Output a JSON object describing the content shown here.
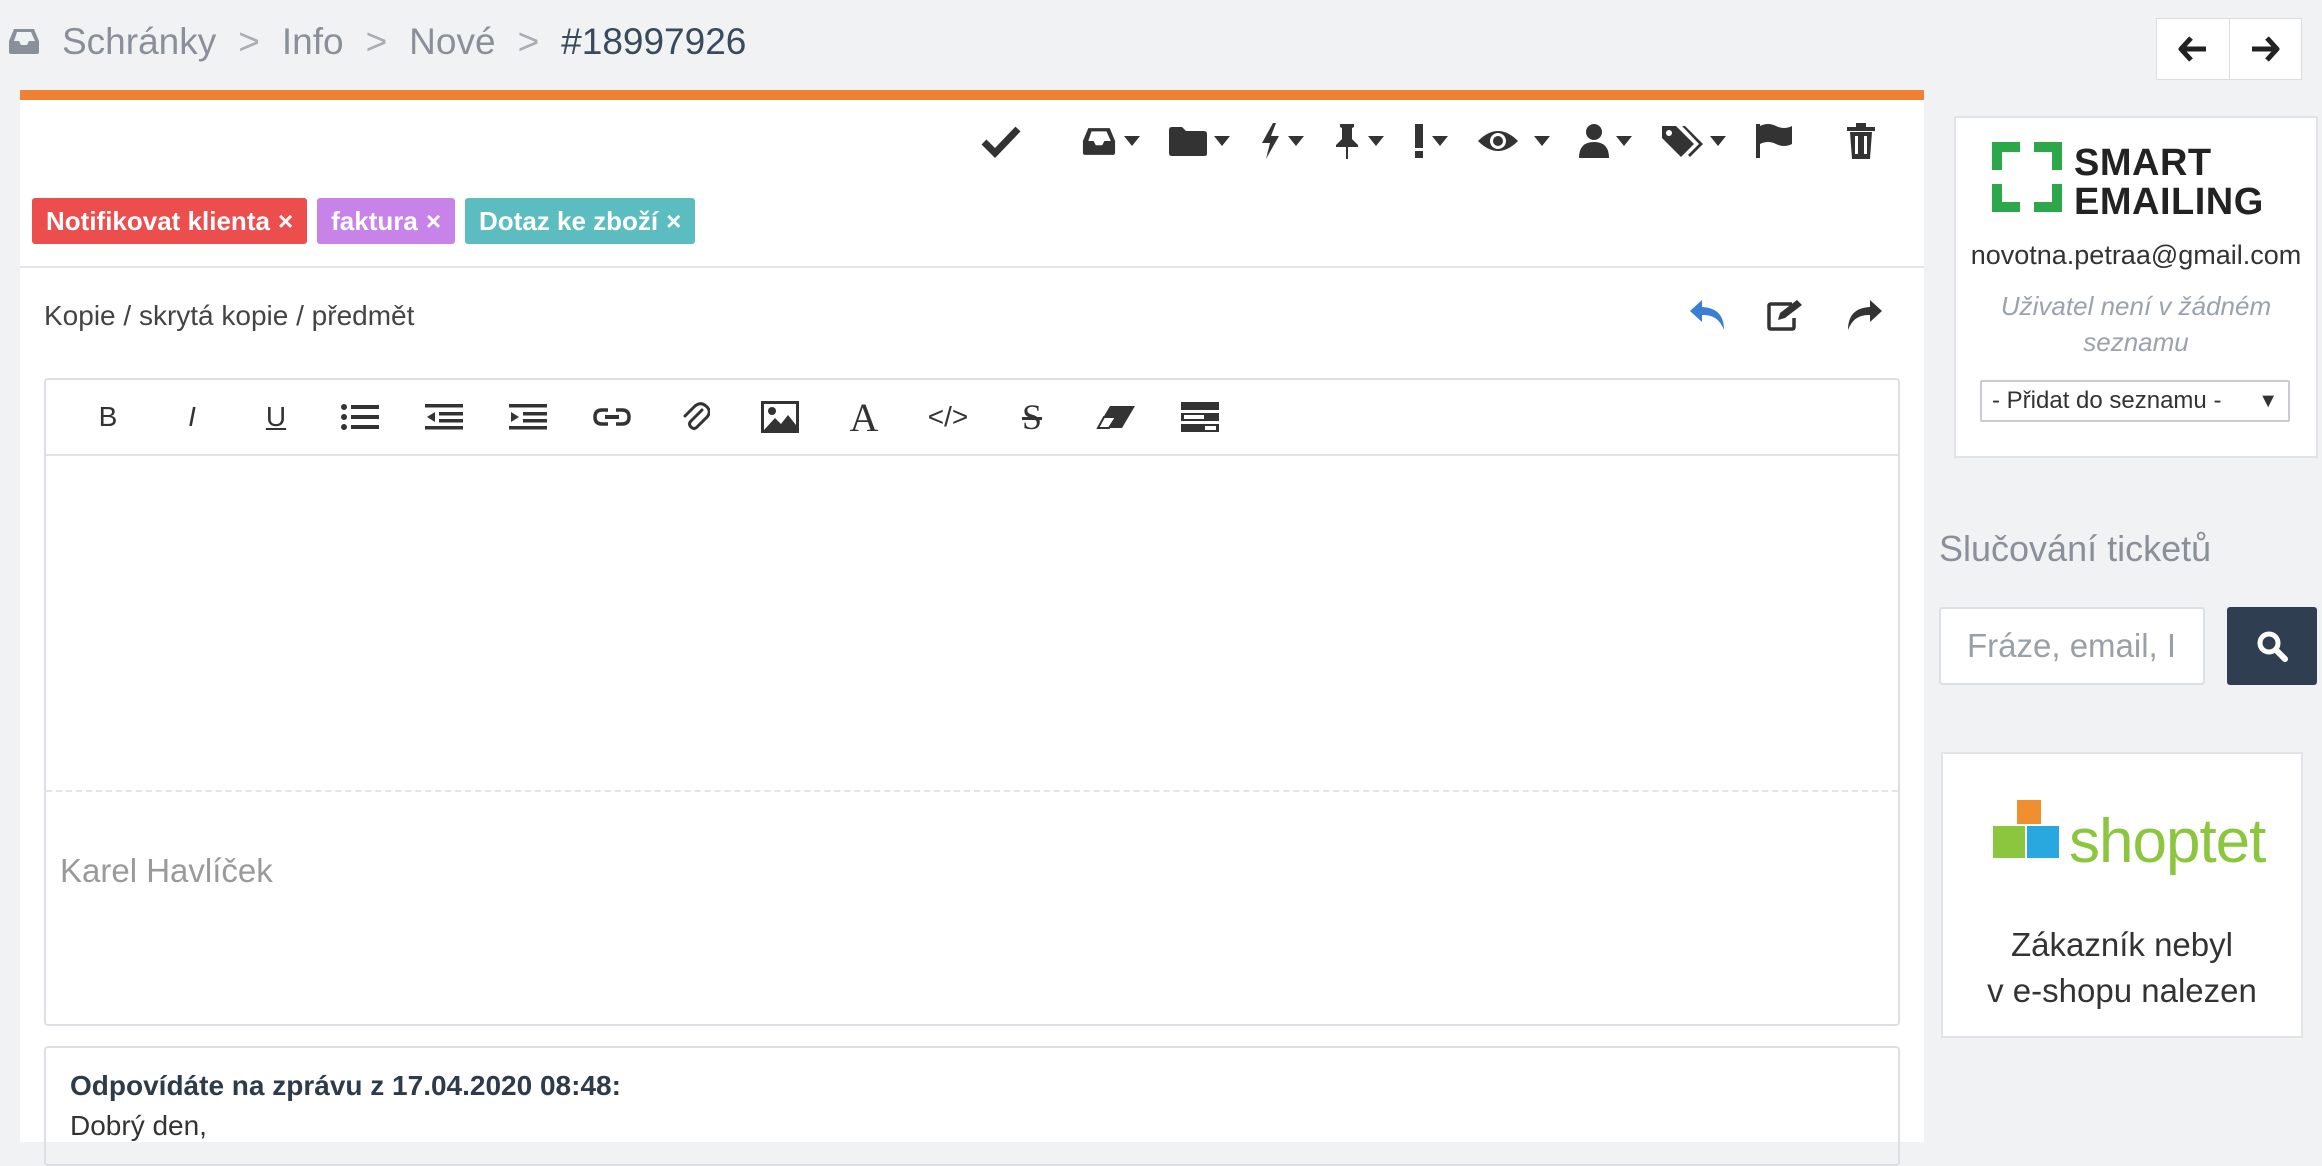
{
  "breadcrumb": {
    "icon": "inbox-icon",
    "items": [
      "Schránky",
      "Info",
      "Nové"
    ],
    "separator": ">",
    "current": "#18997926"
  },
  "nav": {
    "prev_icon": "arrow-left-icon",
    "next_icon": "arrow-right-icon"
  },
  "colors": {
    "accent_orange": "#ee8133",
    "tag_red": "#ec4d4d",
    "tag_purple": "#c783e8",
    "tag_teal": "#5bbdc0",
    "reply_blue": "#3a7ed6",
    "search_button": "#2f3e50",
    "smartemailing_green": "#2ca84a",
    "shoptet_green": "#8cc63f"
  },
  "toolbar": {
    "buttons": [
      {
        "icon": "check-icon",
        "dropdown": false
      },
      {
        "icon": "inbox-icon",
        "dropdown": true
      },
      {
        "icon": "folder-icon",
        "dropdown": true
      },
      {
        "icon": "bolt-icon",
        "dropdown": true
      },
      {
        "icon": "pin-icon",
        "dropdown": true
      },
      {
        "icon": "exclamation-icon",
        "dropdown": true
      },
      {
        "icon": "eye-icon",
        "dropdown": true
      },
      {
        "icon": "user-icon",
        "dropdown": true
      },
      {
        "icon": "tags-icon",
        "dropdown": true
      },
      {
        "icon": "flag-icon",
        "dropdown": false
      },
      {
        "icon": "trash-icon",
        "dropdown": false
      }
    ]
  },
  "tags": [
    {
      "label": "Notifikovat klienta",
      "remove": "×",
      "color": "#ec4d4d"
    },
    {
      "label": "faktura",
      "remove": "×",
      "color": "#c783e8"
    },
    {
      "label": "Dotaz ke zboží",
      "remove": "×",
      "color": "#5bbdc0"
    }
  ],
  "reply": {
    "subject_link": "Kopie / skrytá kopie / předmět",
    "actions": [
      "reply-icon",
      "edit-icon",
      "forward-icon"
    ]
  },
  "editor": {
    "tools": [
      {
        "name": "bold-button",
        "label": "B"
      },
      {
        "name": "italic-button",
        "label": "I"
      },
      {
        "name": "underline-button",
        "label": "U"
      },
      {
        "name": "bullet-list-button",
        "label": ""
      },
      {
        "name": "outdent-button",
        "label": ""
      },
      {
        "name": "indent-button",
        "label": ""
      },
      {
        "name": "link-button",
        "label": ""
      },
      {
        "name": "attach-button",
        "label": ""
      },
      {
        "name": "image-button",
        "label": ""
      },
      {
        "name": "font-button",
        "label": "A"
      },
      {
        "name": "code-button",
        "label": "</>"
      },
      {
        "name": "strikethrough-button",
        "label": "S"
      },
      {
        "name": "eraser-button",
        "label": ""
      },
      {
        "name": "template-button",
        "label": ""
      }
    ],
    "signature": "Karel Havlíček"
  },
  "quote": {
    "heading": "Odpovídáte na zprávu z 17.04.2020 08:48:",
    "first_line": "Dobrý den,"
  },
  "smartemailing": {
    "wordmark_line1": "SMART",
    "wordmark_line2": "EMAILING",
    "email": "novotna.petraa@gmail.com",
    "note": "Uživatel není v žádném seznamu",
    "select_value": "- Přidat do seznamu -",
    "select_arrow": "▼"
  },
  "merge": {
    "title": "Slučování ticketů",
    "placeholder": "Fráze, email, I",
    "button_icon": "search-icon"
  },
  "shoptet": {
    "wordmark": "shoptet",
    "message_line1": "Zákazník nebyl",
    "message_line2": "v e-shopu nalezen"
  }
}
